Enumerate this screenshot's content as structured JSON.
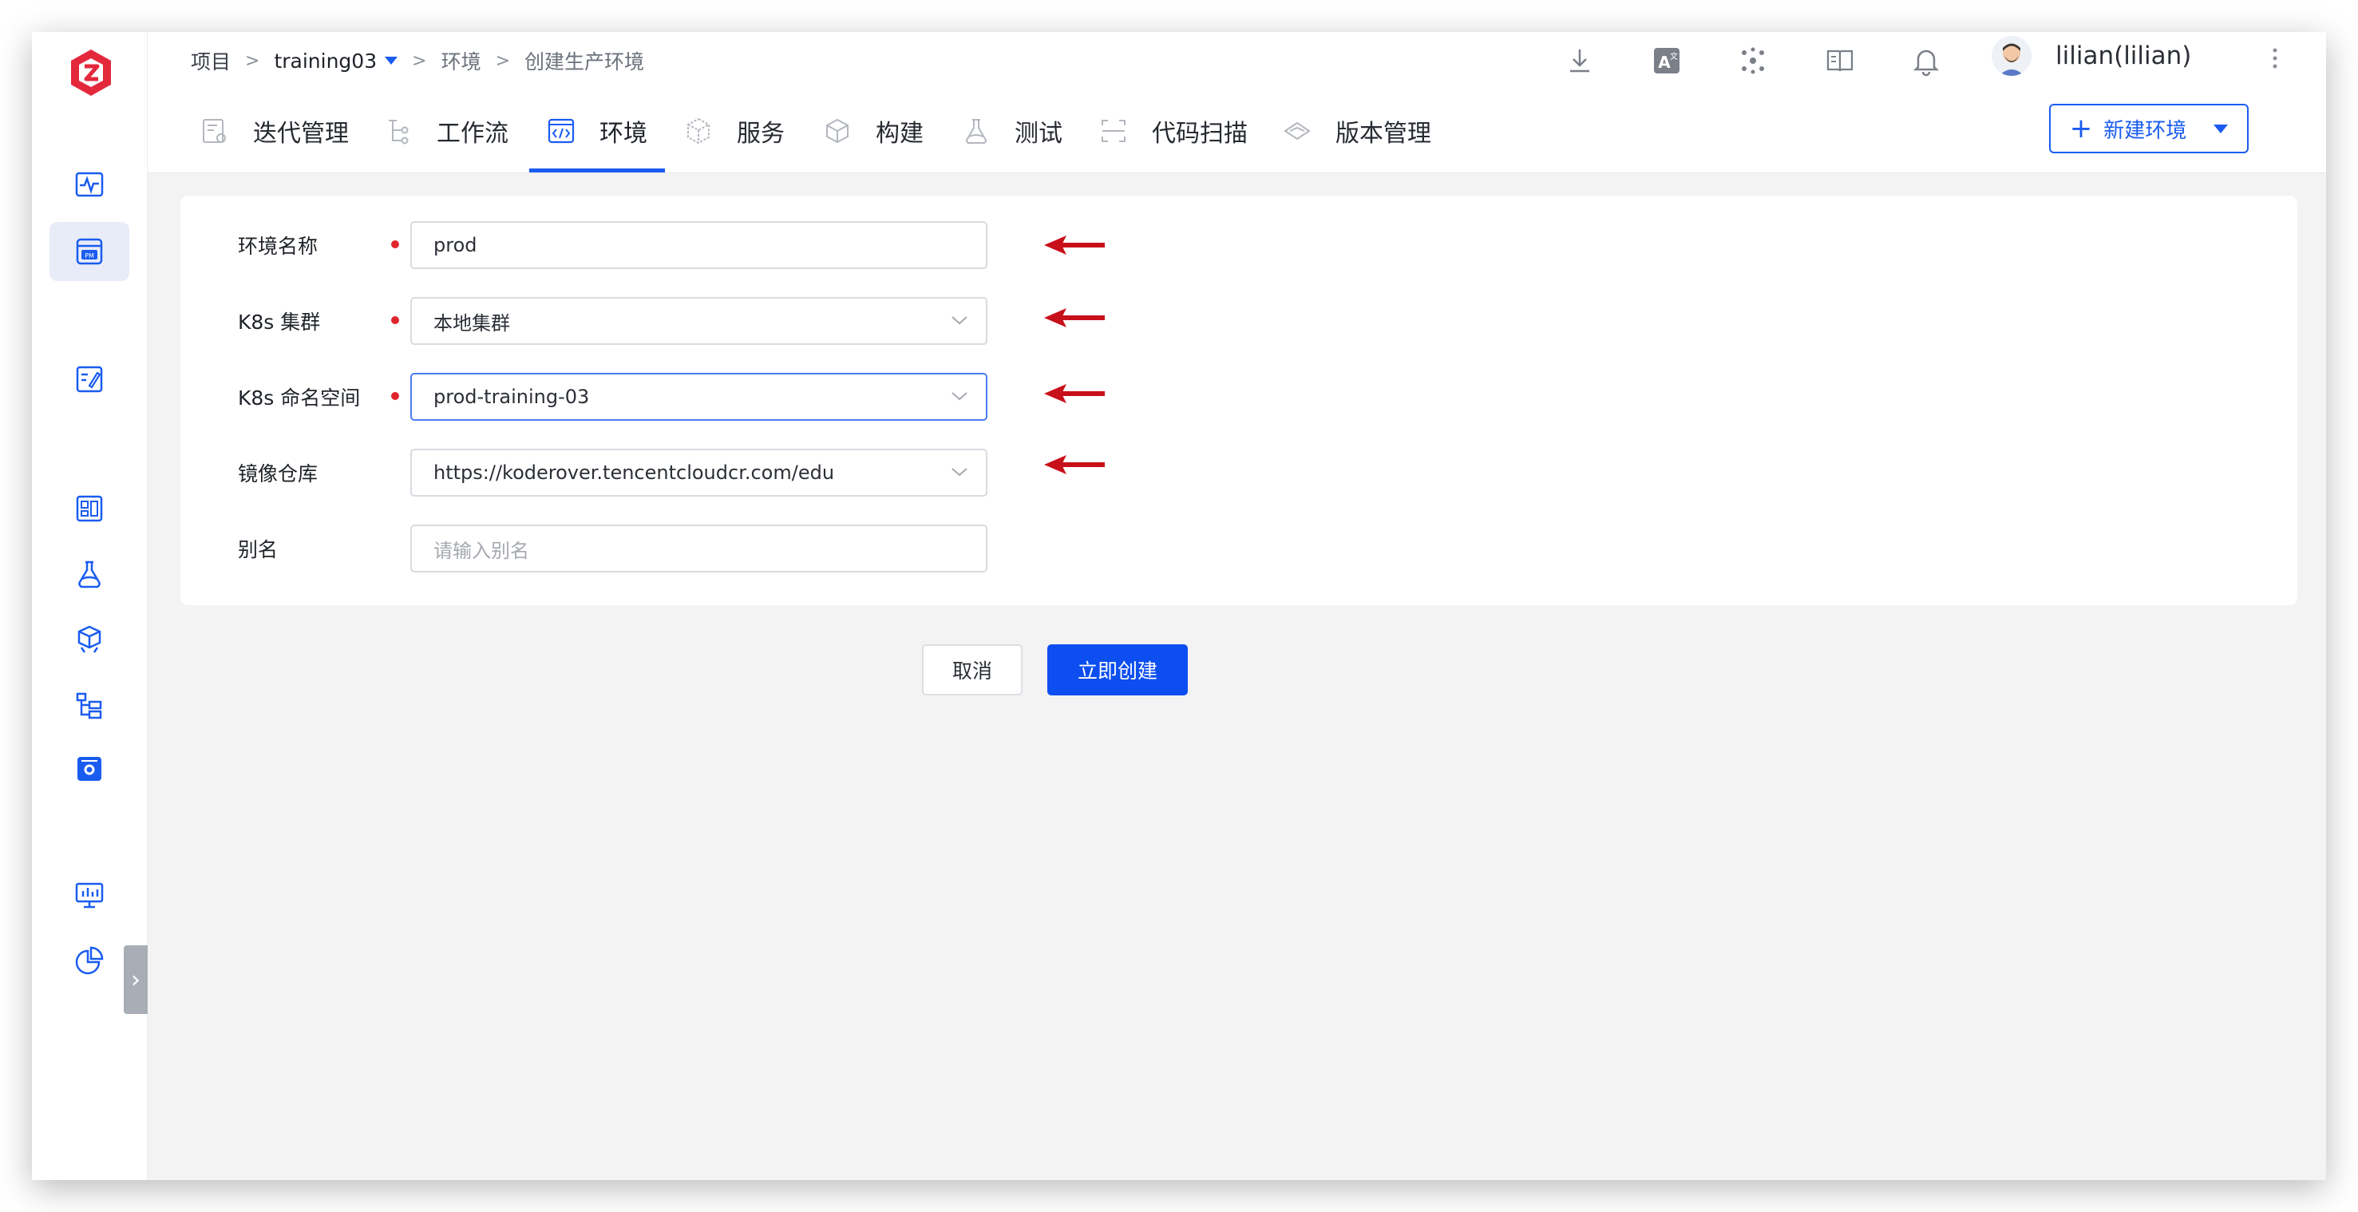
{
  "breadcrumb": {
    "root": "项目",
    "separator": ">",
    "project": "training03",
    "section": "环境",
    "page": "创建生产环境"
  },
  "user": {
    "name": "lilian(lilian)"
  },
  "toolbar_icons": [
    "download-icon",
    "translate-icon",
    "integration-icon",
    "docs-icon",
    "bell-icon",
    "more-icon"
  ],
  "rail_icons": [
    "monitor-wave-icon",
    "pm-icon",
    "edit-doc-icon",
    "dashboard-icon",
    "flask-icon",
    "package-icon",
    "workflow-tree-icon",
    "settings-box-icon",
    "analytics-screen-icon",
    "pie-chart-icon"
  ],
  "tabs": [
    {
      "label": "迭代管理",
      "icon": "iteration-icon"
    },
    {
      "label": "工作流",
      "icon": "workflow-icon"
    },
    {
      "label": "环境",
      "icon": "code-env-icon",
      "active": true
    },
    {
      "label": "服务",
      "icon": "service-cube-icon"
    },
    {
      "label": "构建",
      "icon": "build-box-icon"
    },
    {
      "label": "测试",
      "icon": "test-flask-icon"
    },
    {
      "label": "代码扫描",
      "icon": "scan-icon"
    },
    {
      "label": "版本管理",
      "icon": "version-diamond-icon"
    }
  ],
  "new_env_button": {
    "plus": "+",
    "label": "新建环境"
  },
  "form": {
    "env_name": {
      "label": "环境名称",
      "value": "prod",
      "required": true
    },
    "cluster": {
      "label": "K8s 集群",
      "value": "本地集群",
      "required": true
    },
    "namespace": {
      "label": "K8s 命名空间",
      "value": "prod-training-03",
      "required": true
    },
    "registry": {
      "label": "镜像仓库",
      "value": "https://koderover.tencentcloudcr.com/edu",
      "required": false
    },
    "alias": {
      "label": "别名",
      "placeholder": "请输入别名",
      "required": false
    }
  },
  "actions": {
    "cancel": "取消",
    "create": "立即创建"
  },
  "colors": {
    "primary": "#0c4ef0",
    "required": "#e0242b",
    "annotation_arrow": "#c8101a",
    "logo": "#e3283c"
  }
}
